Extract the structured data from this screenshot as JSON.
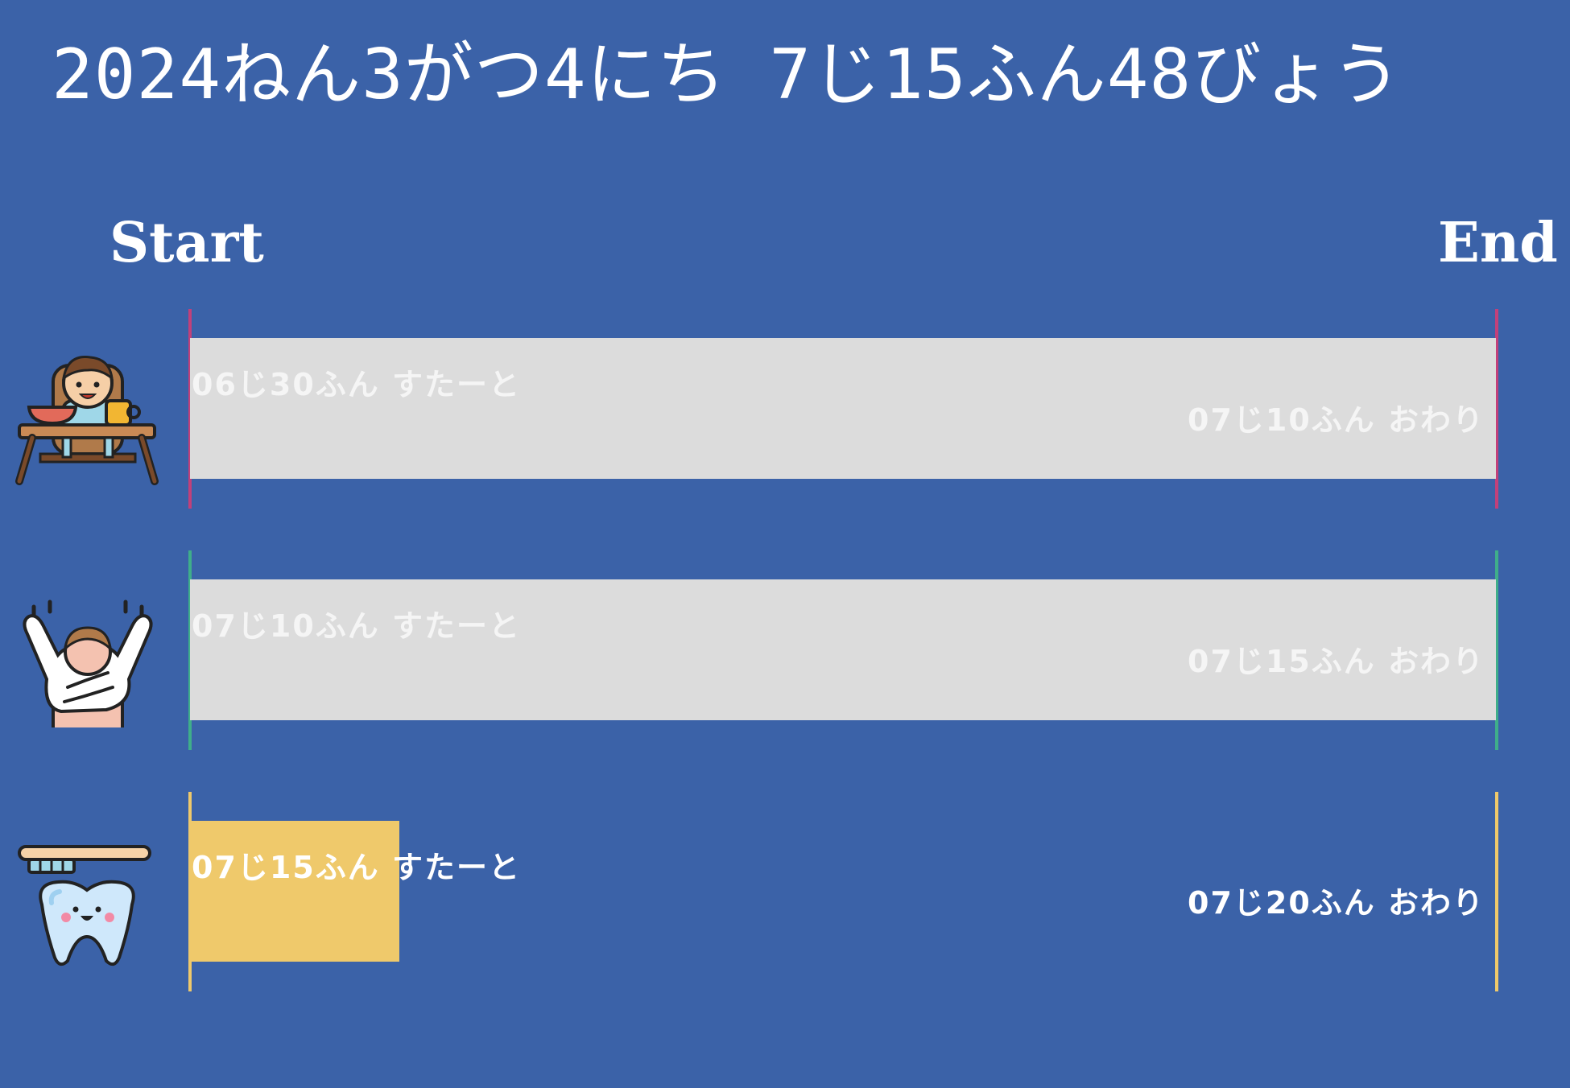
{
  "header": {
    "datetime": "2024ねん3がつ4にち 7じ15ふん48びょう"
  },
  "axis": {
    "start_label": "Start",
    "end_label": "End"
  },
  "colors": {
    "background": "#3b62a8",
    "track": "#dcdcdc"
  },
  "tasks": [
    {
      "icon": "baby-eating-icon",
      "start_text": "06じ30ふん すたーと",
      "end_text": "07じ10ふん おわり",
      "progress": 1.0,
      "color": "#c2407a",
      "fill_color": "#dcdcdc"
    },
    {
      "icon": "child-changing-clothes-icon",
      "start_text": "07じ10ふん すたーと",
      "end_text": "07じ15ふん おわり",
      "progress": 1.0,
      "color": "#3fae8a",
      "fill_color": "#dcdcdc"
    },
    {
      "icon": "tooth-brushing-icon",
      "start_text": "07じ15ふん すたーと",
      "end_text": "07じ20ふん おわり",
      "progress": 0.16,
      "color": "#efc96b",
      "fill_color": "#efc96b"
    }
  ]
}
